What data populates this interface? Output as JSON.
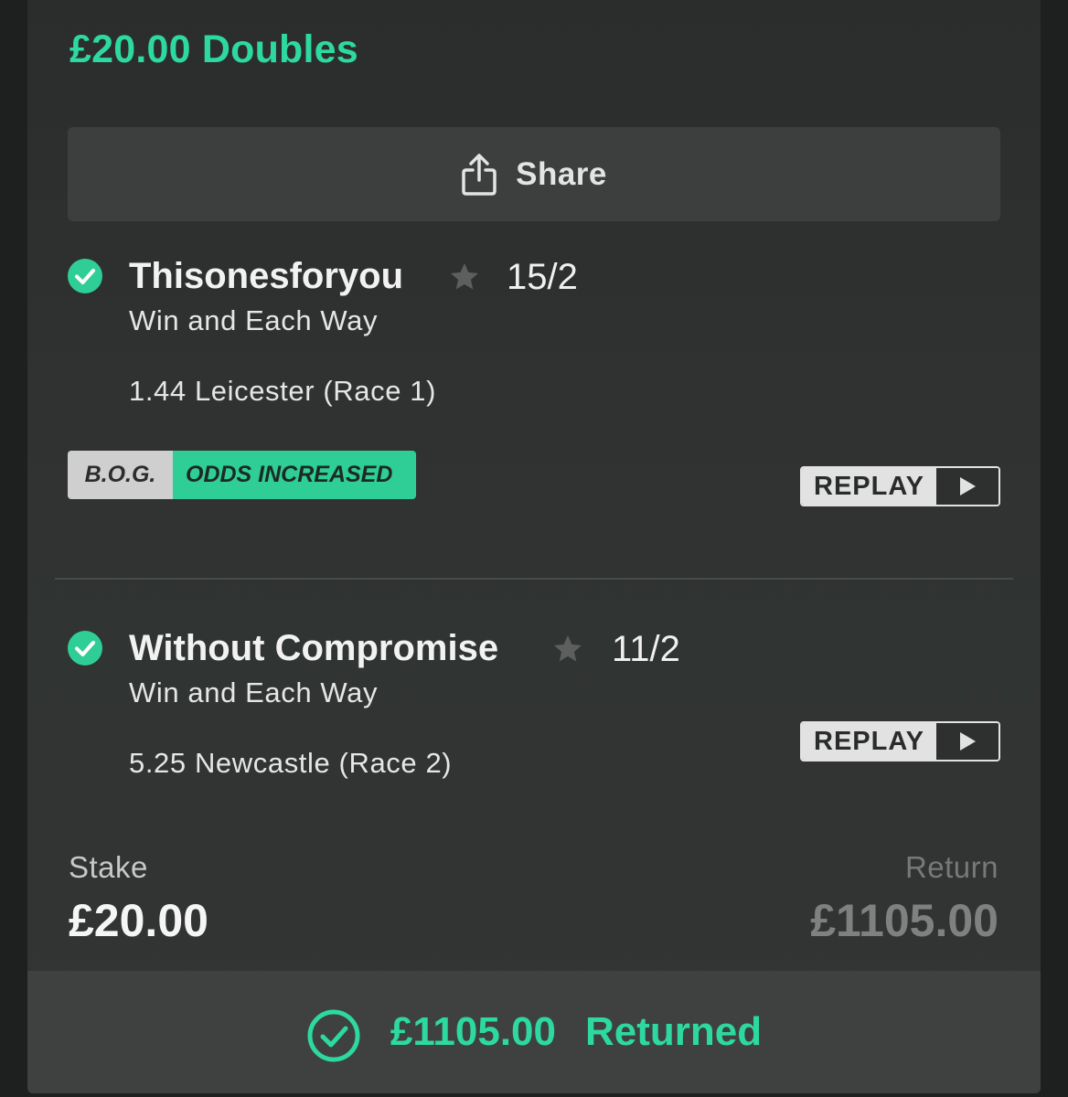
{
  "bet": {
    "title": "£20.00 Doubles"
  },
  "share": {
    "label": "Share",
    "icon": "share-icon"
  },
  "selections": [
    {
      "name": "Thisonesforyou",
      "odds": "15/2",
      "market": "Win and Each Way",
      "event": "1.44 Leicester (Race 1)",
      "status_icon": "check-circle-icon",
      "badge": {
        "left": "B.O.G.",
        "right": "ODDS INCREASED"
      },
      "replay_label": "REPLAY"
    },
    {
      "name": "Without Compromise",
      "odds": "11/2",
      "market": "Win and Each Way",
      "event": "5.25 Newcastle (Race 2)",
      "status_icon": "check-circle-icon",
      "replay_label": "REPLAY"
    }
  ],
  "summary": {
    "stake_label": "Stake",
    "stake_value": "£20.00",
    "return_label": "Return",
    "return_value": "£1105.00"
  },
  "returned": {
    "amount": "£1105.00",
    "label": "Returned"
  },
  "colors": {
    "accent": "#2dd9a0",
    "badge_green": "#2fce97",
    "background": "#2f3231"
  }
}
